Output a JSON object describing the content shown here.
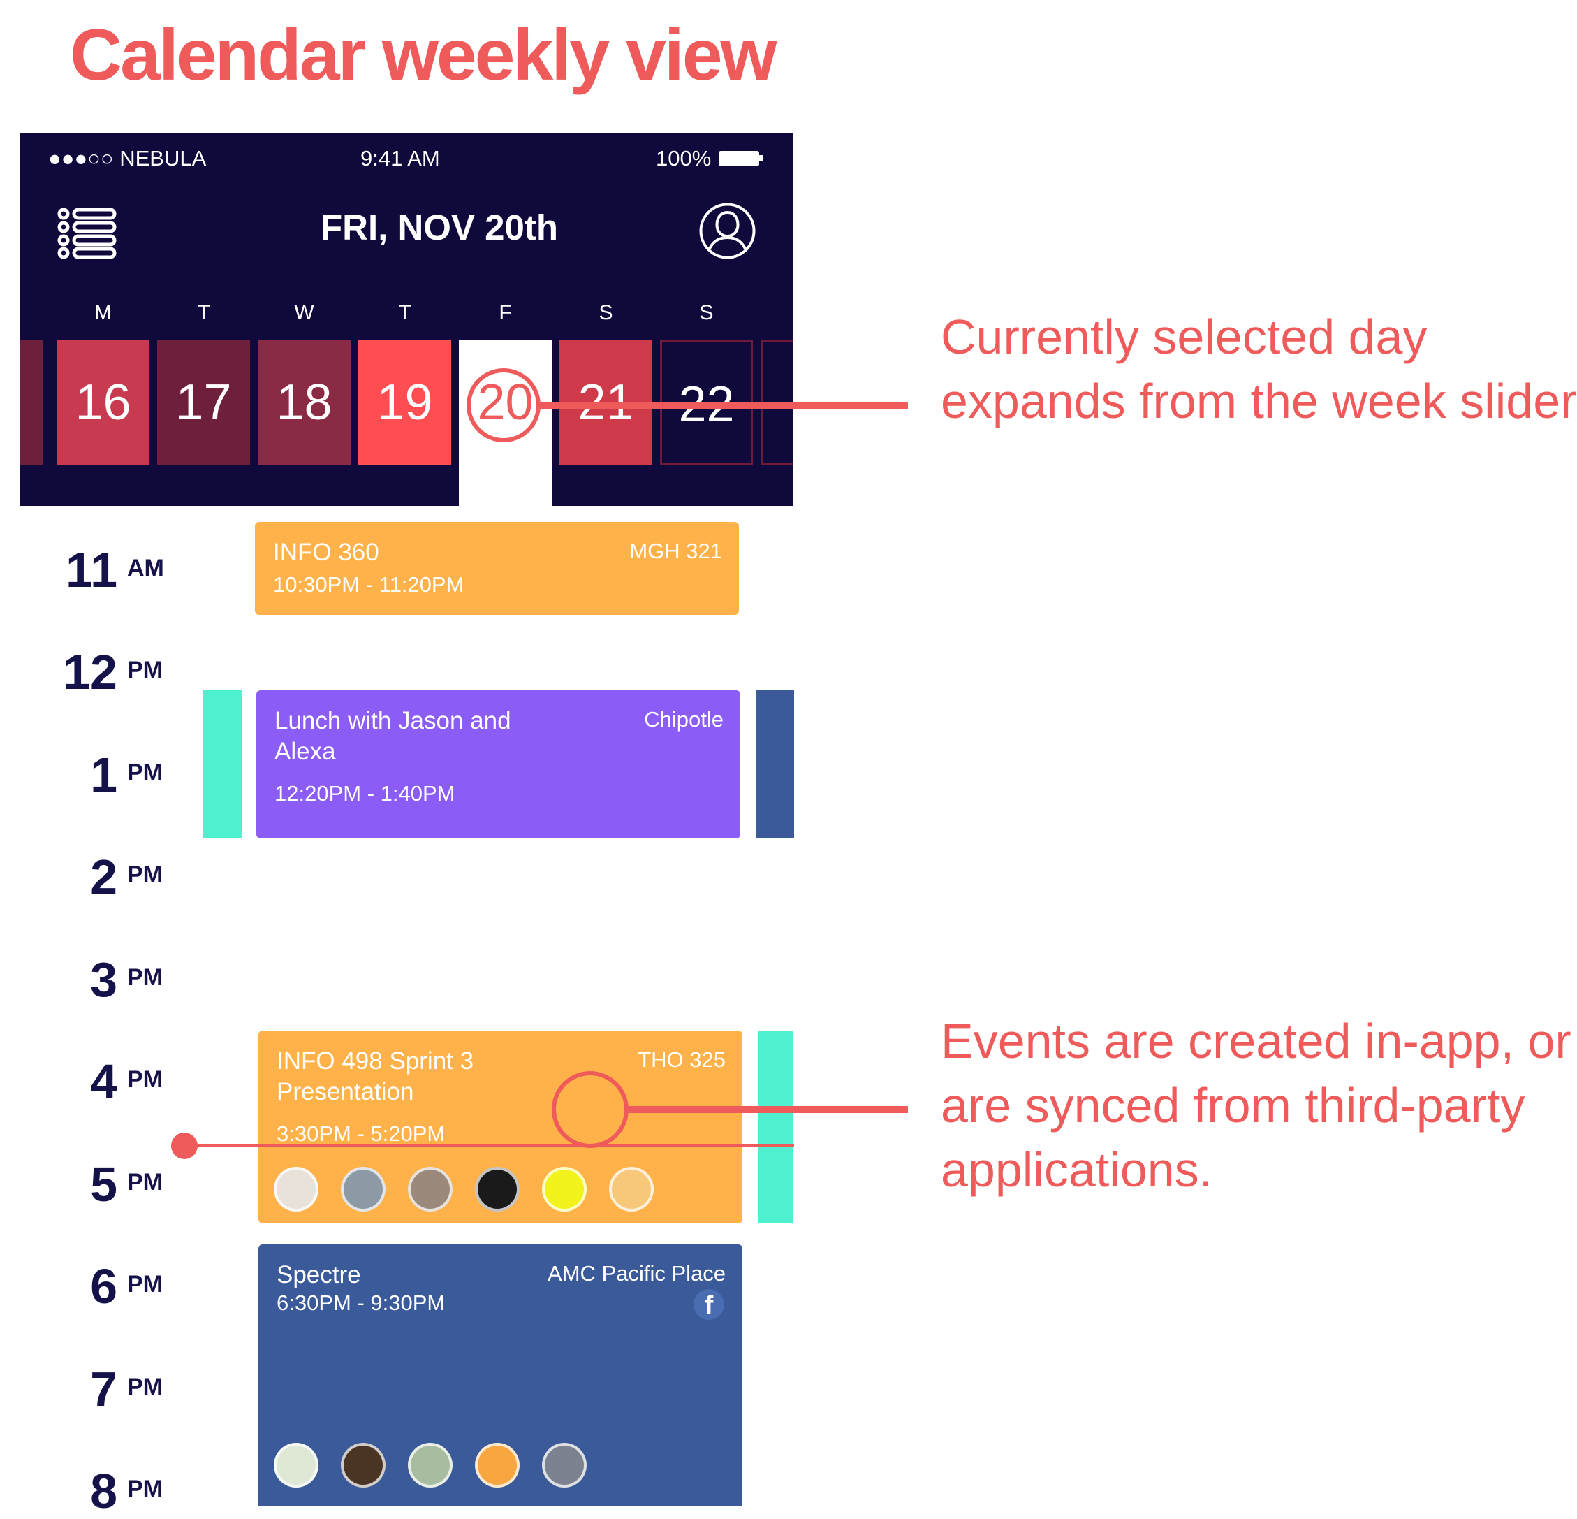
{
  "title": "Calendar weekly view",
  "status_bar": {
    "carrier": "●●●○○ NEBULA",
    "time": "9:41 AM",
    "battery": "100%"
  },
  "header": {
    "date": "FRI, NOV 20th",
    "menu_icon": "list-icon",
    "profile_icon": "user-icon"
  },
  "week": {
    "weekdays": [
      "M",
      "T",
      "W",
      "T",
      "F",
      "S",
      "S"
    ],
    "days": [
      "16",
      "17",
      "18",
      "19",
      "20",
      "21",
      "22"
    ],
    "selected_day": "20",
    "tile_colors": [
      "#c83a50",
      "#6e1f3c",
      "#8a2a45",
      "#ff4d52",
      "#ffffff",
      "#cf3a4a",
      "#100a3c"
    ]
  },
  "hours": [
    {
      "num": "11",
      "suffix": "AM"
    },
    {
      "num": "12",
      "suffix": "PM"
    },
    {
      "num": "1",
      "suffix": "PM"
    },
    {
      "num": "2",
      "suffix": "PM"
    },
    {
      "num": "3",
      "suffix": "PM"
    },
    {
      "num": "4",
      "suffix": "PM"
    },
    {
      "num": "5",
      "suffix": "PM"
    },
    {
      "num": "6",
      "suffix": "PM"
    },
    {
      "num": "7",
      "suffix": "PM"
    },
    {
      "num": "8",
      "suffix": "PM"
    }
  ],
  "events": [
    {
      "title": "INFO 360",
      "time": "10:30PM - 11:20PM",
      "location": "MGH 321",
      "color": "#ffb24a"
    },
    {
      "title": "Lunch with Jason and\nAlexa",
      "time": "12:20PM - 1:40PM",
      "location": "Chipotle",
      "color": "#8c5cf6"
    },
    {
      "title": "INFO 498 Sprint 3\nPresentation",
      "time": "3:30PM - 5:20PM",
      "location": "THO 325",
      "color": "#ffb24a"
    },
    {
      "title": "Spectre",
      "time": "6:30PM - 9:30PM",
      "location": "AMC Pacific Place",
      "color": "#3b5a9a",
      "source_icon": "facebook-icon",
      "source_glyph": "f"
    }
  ],
  "colors": {
    "accent": "#ef5a5a",
    "navy": "#100a3c",
    "teal": "#4ff0cf",
    "blue": "#3b5a9a"
  },
  "annotations": {
    "selected_day": [
      "Currently selected day",
      "expands from the week slider."
    ],
    "events_sync": [
      "Events are created in-app, or",
      "are synced from third-party",
      "applications."
    ]
  }
}
